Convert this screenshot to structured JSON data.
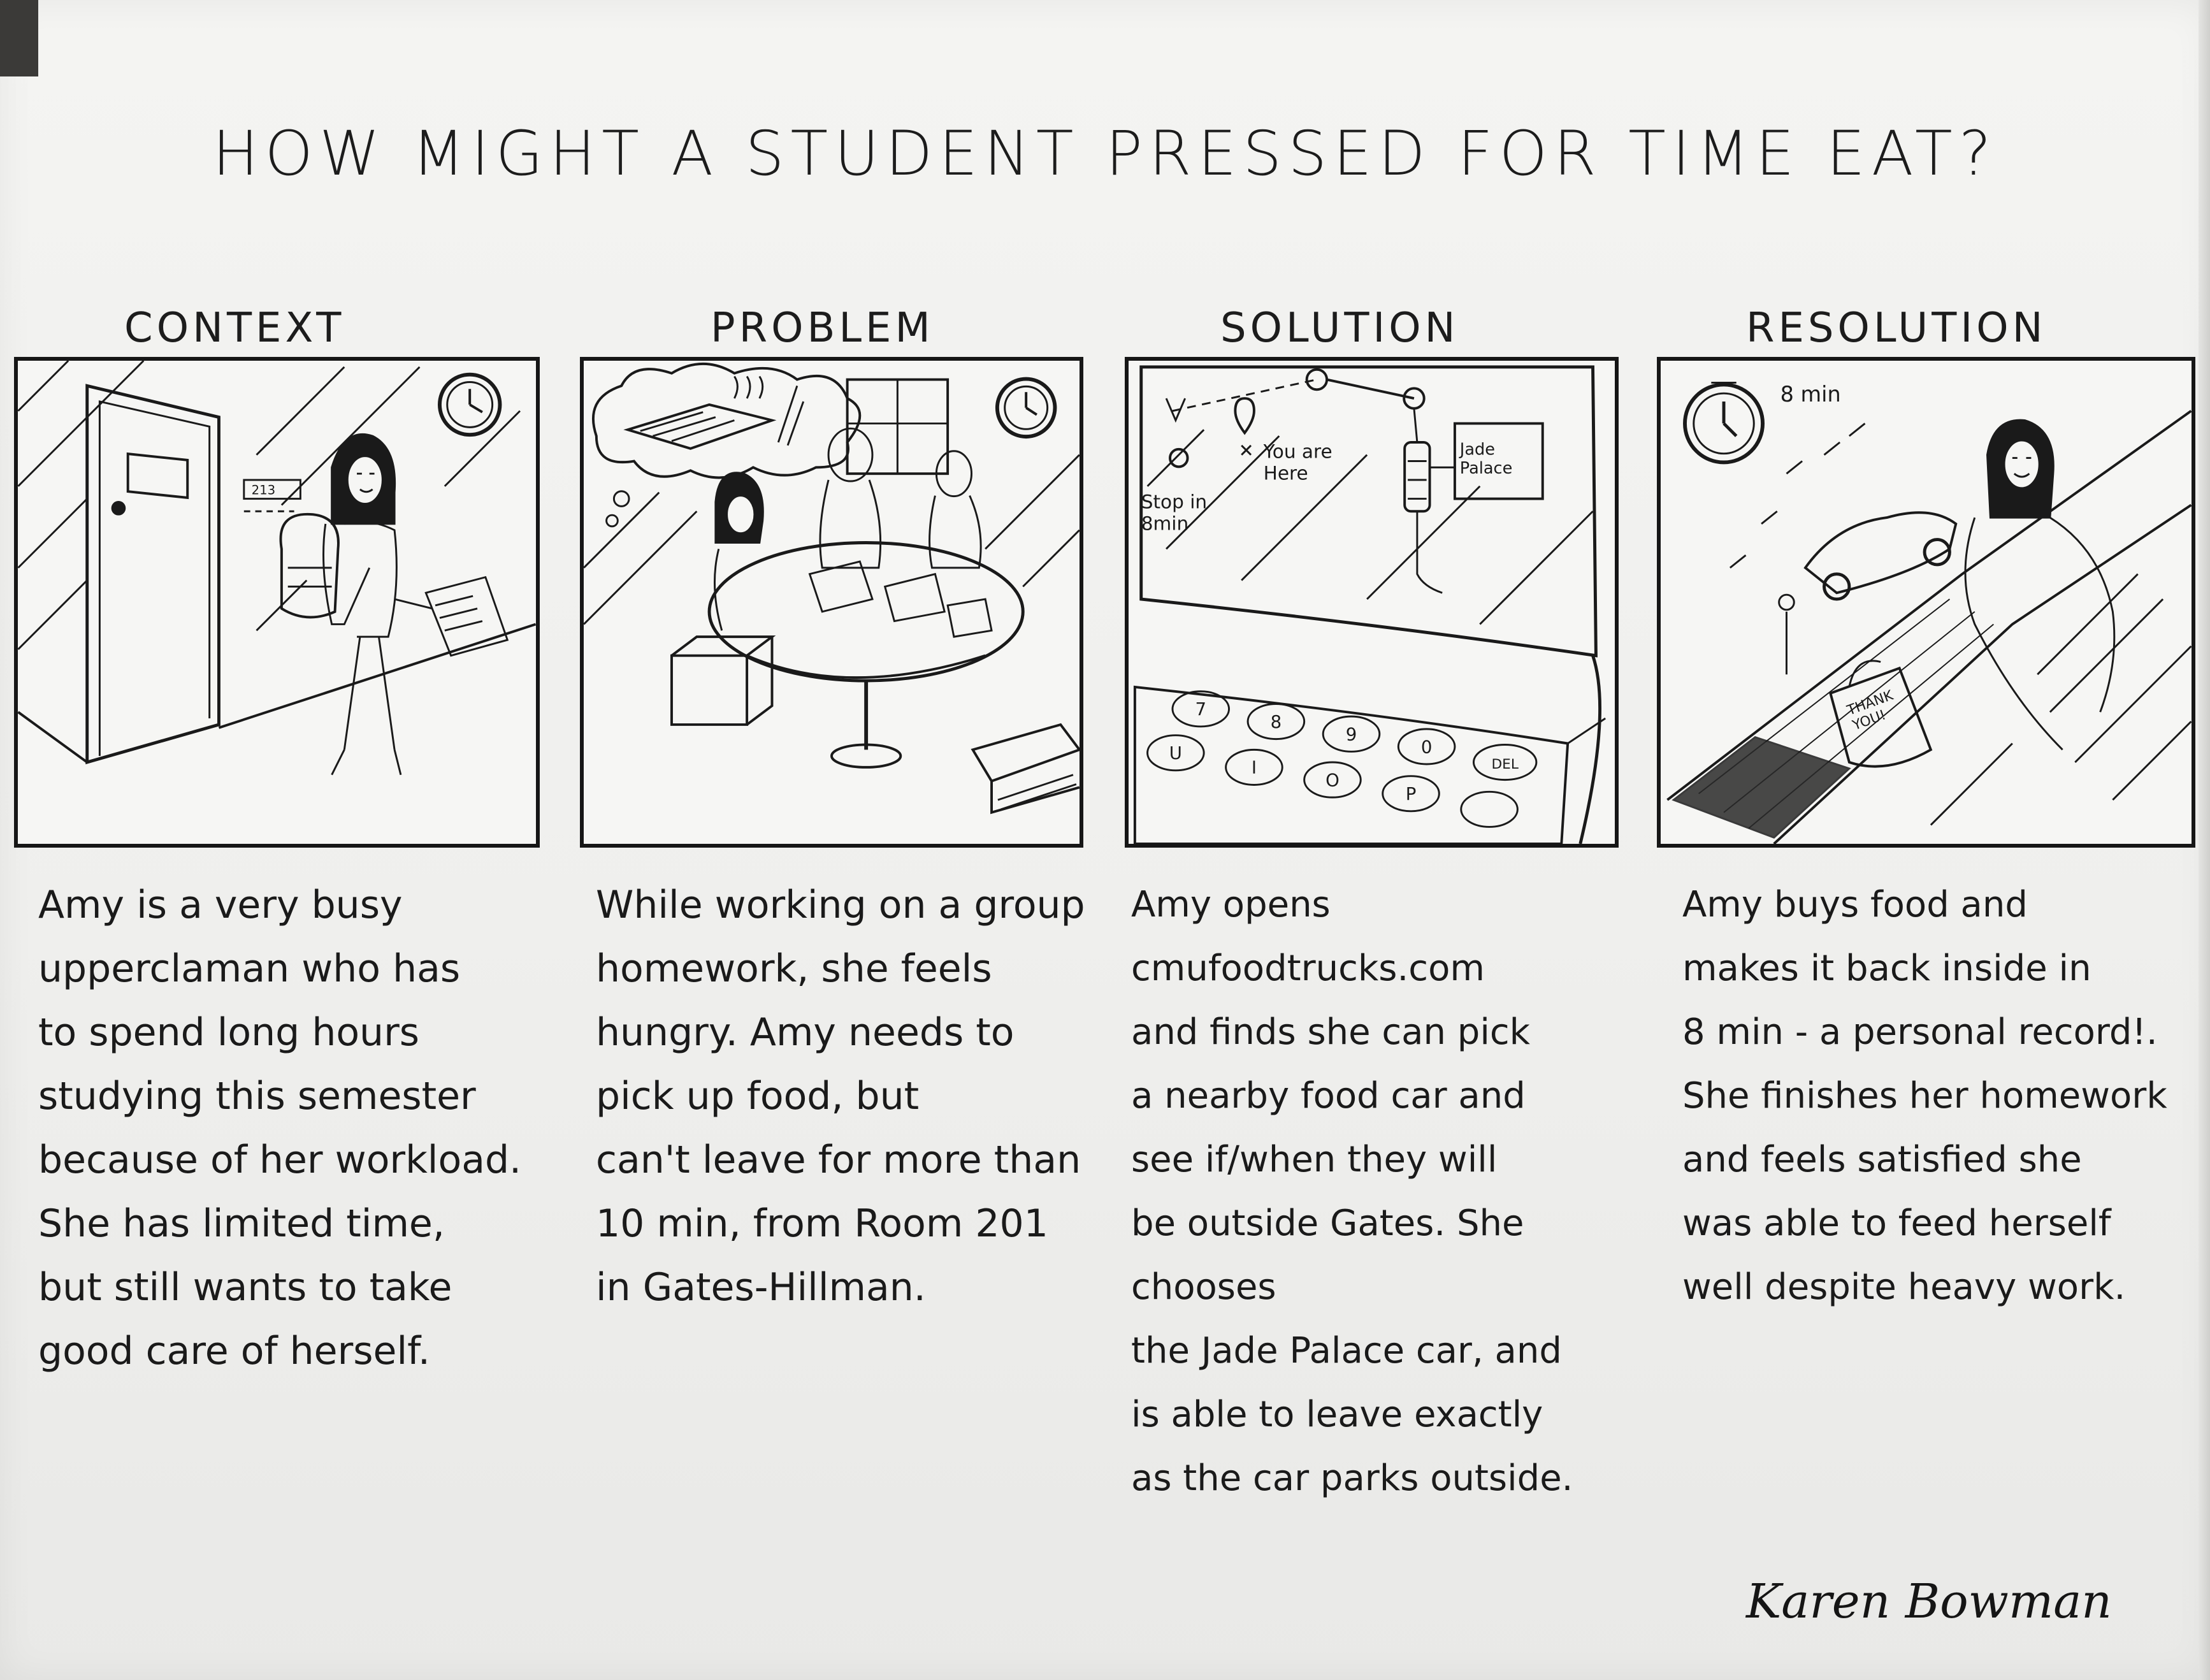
{
  "title": "HOW MIGHT A STUDENT PRESSED FOR TIME EAT?",
  "panels": [
    {
      "heading": "CONTEXT",
      "room_number": "213",
      "caption": "Amy is a very busy\nupperclaman who has\nto spend long hours\nstudying this semester\nbecause of her workload.\nShe has limited time,\nbut still wants to take\ngood care of herself."
    },
    {
      "heading": "PROBLEM",
      "caption": "While working on a group\nhomework, she feels\nhungry. Amy needs to\npick up food, but\ncan't leave for more than\n10 min, from Room 201\nin Gates-Hillman."
    },
    {
      "heading": "SOLUTION",
      "map_labels": {
        "stop": "Stop in\n8min",
        "you_are_here": "You are\nHere",
        "destination": "Jade\nPalace"
      },
      "keyboard_keys": [
        "7",
        "8",
        "9",
        "0",
        "DEL",
        "U",
        "I",
        "O",
        "P"
      ],
      "caption": "Amy opens cmufoodtrucks.com\nand finds she can pick\na nearby food car and\nsee if/when they will\nbe outside Gates. She chooses\nthe Jade Palace car, and\nis able to leave exactly\nas the car parks outside."
    },
    {
      "heading": "RESOLUTION",
      "timer_label": "8 min",
      "bag_text": "THANK\nYOU!",
      "caption": "Amy buys food and\nmakes it back inside in\n8 min - a personal record!.\nShe finishes her homework\nand feels satisfied she\nwas able to feed herself\nwell despite heavy work."
    }
  ],
  "signature": "Karen Bowman",
  "colors": {
    "paper": "#f1f1ef",
    "ink": "#1a1a1a",
    "background": "#5a5147"
  }
}
